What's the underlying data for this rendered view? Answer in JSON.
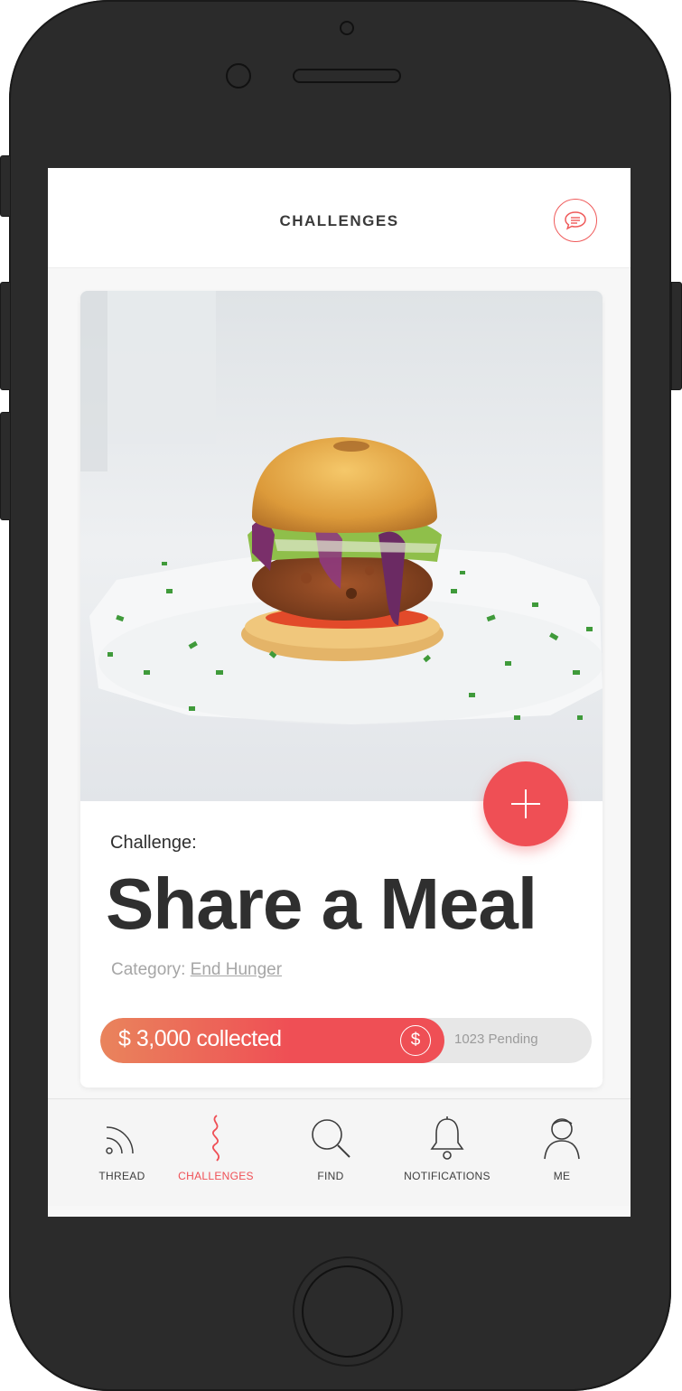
{
  "header": {
    "title": "CHALLENGES",
    "chat_icon": "chat-bubble-icon"
  },
  "challenge": {
    "label": "Challenge:",
    "name": "Share a Meal",
    "category_label": "Category:",
    "category_value": "End Hunger",
    "collected_text": "$ 3,000 collected",
    "currency_symbol": "$",
    "pending_text": "1023 Pending",
    "progress_fraction": 0.7
  },
  "tabs": [
    {
      "label": "THREAD",
      "icon": "rss-icon",
      "active": false
    },
    {
      "label": "CHALLENGES",
      "icon": "squiggle-icon",
      "active": true
    },
    {
      "label": "FIND",
      "icon": "search-icon",
      "active": false
    },
    {
      "label": "NOTIFICATIONS",
      "icon": "bell-icon",
      "active": false
    },
    {
      "label": "ME",
      "icon": "user-icon",
      "active": false
    }
  ],
  "colors": {
    "accent": "#ef4f55",
    "progress_start": "#e9845c",
    "text_dark": "#2f2f2f",
    "muted": "#a6a6a6"
  }
}
